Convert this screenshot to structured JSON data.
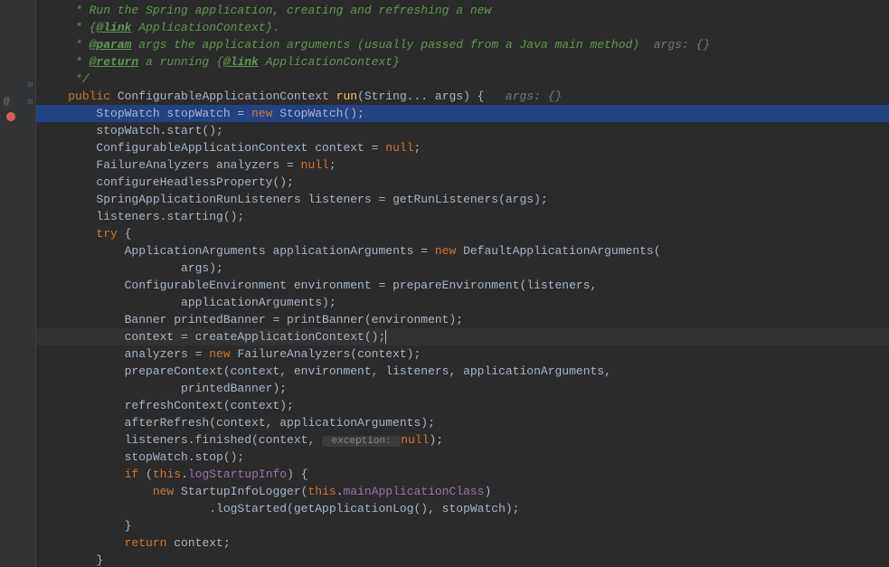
{
  "gutter": {
    "at_symbol": "@",
    "breakpoint_check": "✓"
  },
  "code": {
    "l1": "     * Run the Spring application, creating and refreshing a new",
    "l2_pre": "     * {",
    "l2_link": "@link",
    "l2_post": " ApplicationContext}.",
    "l3_pre": "     * ",
    "l3_tag": "@param",
    "l3_post": " args the application arguments (usually passed from a Java main method)  ",
    "l3_hint": "args: {}",
    "l4_pre": "     * ",
    "l4_tag": "@return",
    "l4_mid": " a running {",
    "l4_link": "@link",
    "l4_post": " ApplicationContext}",
    "l5": "     */",
    "l6_kw1": "public",
    "l6_type": " ConfigurableApplicationContext ",
    "l6_method": "run",
    "l6_sig": "(String... args) {   ",
    "l6_hint": "args: {}",
    "l7_pre": "        StopWatch stopWatch = ",
    "l7_kw": "new",
    "l7_post": " StopWatch();",
    "l8": "        stopWatch.start();",
    "l9_pre": "        ConfigurableApplicationContext context = ",
    "l9_kw": "null",
    "l9_post": ";",
    "l10_pre": "        FailureAnalyzers analyzers = ",
    "l10_kw": "null",
    "l10_post": ";",
    "l11": "        configureHeadlessProperty();",
    "l12": "        SpringApplicationRunListeners listeners = getRunListeners(args);",
    "l13": "        listeners.starting();",
    "l14_kw": "try",
    "l14_post": " {",
    "l15_pre": "            ApplicationArguments applicationArguments = ",
    "l15_kw": "new",
    "l15_post": " DefaultApplicationArguments(",
    "l16": "                    args);",
    "l17": "            ConfigurableEnvironment environment = prepareEnvironment(listeners,",
    "l18": "                    applicationArguments);",
    "l19": "            Banner printedBanner = printBanner(environment);",
    "l20": "            context = createApplicationContext();",
    "l21_pre": "            analyzers = ",
    "l21_kw": "new",
    "l21_post": " FailureAnalyzers(context);",
    "l22": "            prepareContext(context, environment, listeners, applicationArguments,",
    "l23": "                    printedBanner);",
    "l24": "            refreshContext(context);",
    "l25": "            afterRefresh(context, applicationArguments);",
    "l26_pre": "            listeners.finished(context, ",
    "l26_hint": " exception: ",
    "l26_kw": "null",
    "l26_post": ");",
    "l27": "            stopWatch.stop();",
    "l28_kw": "if",
    "l28_mid": " (",
    "l28_kw2": "this",
    "l28_post": ".",
    "l28_field": "logStartupInfo",
    "l28_end": ") {",
    "l29_kw": "new",
    "l29_mid": " StartupInfoLogger(",
    "l29_kw2": "this",
    "l29_post": ".",
    "l29_field": "mainApplicationClass",
    "l29_end": ")",
    "l30": "                        .logStarted(getApplicationLog(), stopWatch);",
    "l31": "            }",
    "l32_kw": "return",
    "l32_post": " context;",
    "l33": "        }"
  }
}
